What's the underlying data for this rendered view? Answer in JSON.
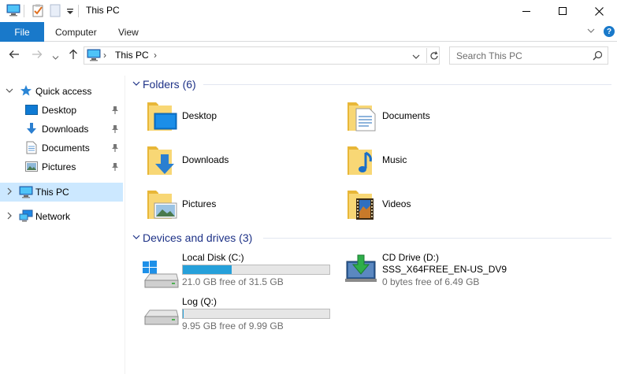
{
  "window": {
    "title": "This PC"
  },
  "ribbon": {
    "file_tab": "File",
    "tabs": [
      "Computer",
      "View"
    ],
    "help": "?"
  },
  "address": {
    "location": "This PC",
    "separator": "›"
  },
  "search": {
    "placeholder": "Search This PC"
  },
  "nav": {
    "quick_access": "Quick access",
    "quick_items": [
      {
        "label": "Desktop",
        "icon": "desktop-icon"
      },
      {
        "label": "Downloads",
        "icon": "downloads-icon"
      },
      {
        "label": "Documents",
        "icon": "documents-icon"
      },
      {
        "label": "Pictures",
        "icon": "pictures-icon"
      }
    ],
    "this_pc": "This PC",
    "network": "Network"
  },
  "content": {
    "folders_header": "Folders (6)",
    "folders": [
      {
        "label": "Desktop",
        "icon": "desktop-folder-icon"
      },
      {
        "label": "Documents",
        "icon": "documents-folder-icon"
      },
      {
        "label": "Downloads",
        "icon": "downloads-folder-icon"
      },
      {
        "label": "Music",
        "icon": "music-folder-icon"
      },
      {
        "label": "Pictures",
        "icon": "pictures-folder-icon"
      },
      {
        "label": "Videos",
        "icon": "videos-folder-icon"
      }
    ],
    "drives_header": "Devices and drives (3)",
    "drives": [
      {
        "name": "Local Disk (C:)",
        "free": "21.0 GB free of 31.5 GB",
        "used_fraction": 0.333,
        "icon": "windows-drive-icon"
      },
      {
        "name": "CD Drive (D:)",
        "label": "SSS_X64FREE_EN-US_DV9",
        "free": "0 bytes free of 6.49 GB",
        "icon": "cd-drive-icon"
      },
      {
        "name": "Log (Q:)",
        "free": "9.95 GB free of 9.99 GB",
        "used_fraction": 0.004,
        "icon": "hard-drive-icon"
      }
    ]
  },
  "colors": {
    "accent": "#1979ca",
    "header_text": "#1e3287",
    "selection": "#cce8ff",
    "bar_fill": "#26a0da"
  }
}
